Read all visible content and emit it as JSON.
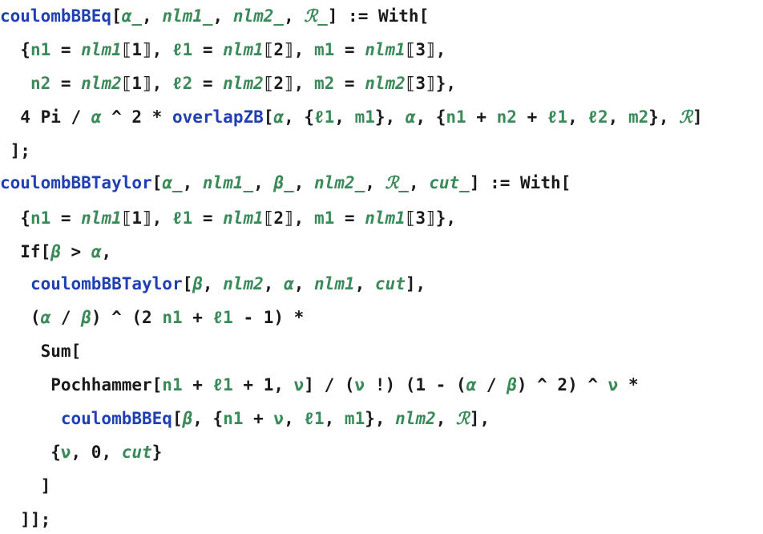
{
  "colors": {
    "function": "#1f3fb3",
    "pattern": "#3a8a5a",
    "local": "#3a8a5a",
    "text": "#1a1a1a",
    "background": "#ffffff"
  },
  "lines": [
    {
      "tokens": [
        {
          "t": "fn",
          "s": "coulombBBEq"
        },
        {
          "t": "sym",
          "s": "["
        },
        {
          "t": "var",
          "s": "α_"
        },
        {
          "t": "sym",
          "s": ", "
        },
        {
          "t": "var",
          "s": "nlm1_"
        },
        {
          "t": "sym",
          "s": ", "
        },
        {
          "t": "var",
          "s": "nlm2_"
        },
        {
          "t": "sym",
          "s": ", "
        },
        {
          "t": "var",
          "s": "ℛ_"
        },
        {
          "t": "sym",
          "s": "] := "
        },
        {
          "t": "plain",
          "s": "With"
        },
        {
          "t": "sym",
          "s": "["
        }
      ]
    },
    {
      "tokens": [
        {
          "t": "sym",
          "s": "  {"
        },
        {
          "t": "loc",
          "s": "n1"
        },
        {
          "t": "sym",
          "s": " = "
        },
        {
          "t": "var",
          "s": "nlm1"
        },
        {
          "t": "sym",
          "s": "⟦1⟧, "
        },
        {
          "t": "loc",
          "s": "ℓ1"
        },
        {
          "t": "sym",
          "s": " = "
        },
        {
          "t": "var",
          "s": "nlm1"
        },
        {
          "t": "sym",
          "s": "⟦2⟧, "
        },
        {
          "t": "loc",
          "s": "m1"
        },
        {
          "t": "sym",
          "s": " = "
        },
        {
          "t": "var",
          "s": "nlm1"
        },
        {
          "t": "sym",
          "s": "⟦3⟧,"
        }
      ]
    },
    {
      "tokens": [
        {
          "t": "sym",
          "s": "   "
        },
        {
          "t": "loc",
          "s": "n2"
        },
        {
          "t": "sym",
          "s": " = "
        },
        {
          "t": "var",
          "s": "nlm2"
        },
        {
          "t": "sym",
          "s": "⟦1⟧, "
        },
        {
          "t": "loc",
          "s": "ℓ2"
        },
        {
          "t": "sym",
          "s": " = "
        },
        {
          "t": "var",
          "s": "nlm2"
        },
        {
          "t": "sym",
          "s": "⟦2⟧, "
        },
        {
          "t": "loc",
          "s": "m2"
        },
        {
          "t": "sym",
          "s": " = "
        },
        {
          "t": "var",
          "s": "nlm2"
        },
        {
          "t": "sym",
          "s": "⟦3⟧},"
        }
      ]
    },
    {
      "tokens": [
        {
          "t": "sym",
          "s": "  4 Pi / "
        },
        {
          "t": "var",
          "s": "α"
        },
        {
          "t": "sym",
          "s": " ^ 2 * "
        },
        {
          "t": "fn",
          "s": "overlapZB"
        },
        {
          "t": "sym",
          "s": "["
        },
        {
          "t": "var",
          "s": "α"
        },
        {
          "t": "sym",
          "s": ", {"
        },
        {
          "t": "loc",
          "s": "ℓ1"
        },
        {
          "t": "sym",
          "s": ", "
        },
        {
          "t": "loc",
          "s": "m1"
        },
        {
          "t": "sym",
          "s": "}, "
        },
        {
          "t": "var",
          "s": "α"
        },
        {
          "t": "sym",
          "s": ", {"
        },
        {
          "t": "loc",
          "s": "n1"
        },
        {
          "t": "sym",
          "s": " + "
        },
        {
          "t": "loc",
          "s": "n2"
        },
        {
          "t": "sym",
          "s": " + "
        },
        {
          "t": "loc",
          "s": "ℓ1"
        },
        {
          "t": "sym",
          "s": ", "
        },
        {
          "t": "loc",
          "s": "ℓ2"
        },
        {
          "t": "sym",
          "s": ", "
        },
        {
          "t": "loc",
          "s": "m2"
        },
        {
          "t": "sym",
          "s": "}, "
        },
        {
          "t": "var",
          "s": "ℛ"
        },
        {
          "t": "sym",
          "s": "]"
        }
      ]
    },
    {
      "tokens": [
        {
          "t": "sym",
          "s": " ];"
        }
      ]
    },
    {
      "tokens": [
        {
          "t": "fn",
          "s": "coulombBBTaylor"
        },
        {
          "t": "sym",
          "s": "["
        },
        {
          "t": "var",
          "s": "α_"
        },
        {
          "t": "sym",
          "s": ", "
        },
        {
          "t": "var",
          "s": "nlm1_"
        },
        {
          "t": "sym",
          "s": ", "
        },
        {
          "t": "var",
          "s": "β_"
        },
        {
          "t": "sym",
          "s": ", "
        },
        {
          "t": "var",
          "s": "nlm2_"
        },
        {
          "t": "sym",
          "s": ", "
        },
        {
          "t": "var",
          "s": "ℛ_"
        },
        {
          "t": "sym",
          "s": ", "
        },
        {
          "t": "var",
          "s": "cut_"
        },
        {
          "t": "sym",
          "s": "] := "
        },
        {
          "t": "plain",
          "s": "With"
        },
        {
          "t": "sym",
          "s": "["
        }
      ]
    },
    {
      "tokens": [
        {
          "t": "sym",
          "s": "  {"
        },
        {
          "t": "loc",
          "s": "n1"
        },
        {
          "t": "sym",
          "s": " = "
        },
        {
          "t": "var",
          "s": "nlm1"
        },
        {
          "t": "sym",
          "s": "⟦1⟧, "
        },
        {
          "t": "loc",
          "s": "ℓ1"
        },
        {
          "t": "sym",
          "s": " = "
        },
        {
          "t": "var",
          "s": "nlm1"
        },
        {
          "t": "sym",
          "s": "⟦2⟧, "
        },
        {
          "t": "loc",
          "s": "m1"
        },
        {
          "t": "sym",
          "s": " = "
        },
        {
          "t": "var",
          "s": "nlm1"
        },
        {
          "t": "sym",
          "s": "⟦3⟧},"
        }
      ]
    },
    {
      "tokens": [
        {
          "t": "sym",
          "s": "  If["
        },
        {
          "t": "var",
          "s": "β"
        },
        {
          "t": "sym",
          "s": " > "
        },
        {
          "t": "var",
          "s": "α"
        },
        {
          "t": "sym",
          "s": ","
        }
      ]
    },
    {
      "tokens": [
        {
          "t": "sym",
          "s": "   "
        },
        {
          "t": "fn",
          "s": "coulombBBTaylor"
        },
        {
          "t": "sym",
          "s": "["
        },
        {
          "t": "var",
          "s": "β"
        },
        {
          "t": "sym",
          "s": ", "
        },
        {
          "t": "var",
          "s": "nlm2"
        },
        {
          "t": "sym",
          "s": ", "
        },
        {
          "t": "var",
          "s": "α"
        },
        {
          "t": "sym",
          "s": ", "
        },
        {
          "t": "var",
          "s": "nlm1"
        },
        {
          "t": "sym",
          "s": ", "
        },
        {
          "t": "var",
          "s": "cut"
        },
        {
          "t": "sym",
          "s": "],"
        }
      ]
    },
    {
      "tokens": [
        {
          "t": "sym",
          "s": "   ("
        },
        {
          "t": "var",
          "s": "α"
        },
        {
          "t": "sym",
          "s": " / "
        },
        {
          "t": "var",
          "s": "β"
        },
        {
          "t": "sym",
          "s": ") ^ (2 "
        },
        {
          "t": "loc",
          "s": "n1"
        },
        {
          "t": "sym",
          "s": " + "
        },
        {
          "t": "loc",
          "s": "ℓ1"
        },
        {
          "t": "sym",
          "s": " - 1) *"
        }
      ]
    },
    {
      "tokens": [
        {
          "t": "sym",
          "s": "    Sum["
        }
      ]
    },
    {
      "tokens": [
        {
          "t": "sym",
          "s": "     Pochhammer["
        },
        {
          "t": "loc",
          "s": "n1"
        },
        {
          "t": "sym",
          "s": " + "
        },
        {
          "t": "loc",
          "s": "ℓ1"
        },
        {
          "t": "sym",
          "s": " + 1, "
        },
        {
          "t": "loc",
          "s": "ν"
        },
        {
          "t": "sym",
          "s": "] / ("
        },
        {
          "t": "loc",
          "s": "ν"
        },
        {
          "t": "sym",
          "s": " !) (1 - ("
        },
        {
          "t": "var",
          "s": "α"
        },
        {
          "t": "sym",
          "s": " / "
        },
        {
          "t": "var",
          "s": "β"
        },
        {
          "t": "sym",
          "s": ") ^ 2) ^ "
        },
        {
          "t": "loc",
          "s": "ν"
        },
        {
          "t": "sym",
          "s": " *"
        }
      ]
    },
    {
      "tokens": [
        {
          "t": "sym",
          "s": "      "
        },
        {
          "t": "fn",
          "s": "coulombBBEq"
        },
        {
          "t": "sym",
          "s": "["
        },
        {
          "t": "var",
          "s": "β"
        },
        {
          "t": "sym",
          "s": ", {"
        },
        {
          "t": "loc",
          "s": "n1"
        },
        {
          "t": "sym",
          "s": " + "
        },
        {
          "t": "loc",
          "s": "ν"
        },
        {
          "t": "sym",
          "s": ", "
        },
        {
          "t": "loc",
          "s": "ℓ1"
        },
        {
          "t": "sym",
          "s": ", "
        },
        {
          "t": "loc",
          "s": "m1"
        },
        {
          "t": "sym",
          "s": "}, "
        },
        {
          "t": "var",
          "s": "nlm2"
        },
        {
          "t": "sym",
          "s": ", "
        },
        {
          "t": "var",
          "s": "ℛ"
        },
        {
          "t": "sym",
          "s": "],"
        }
      ]
    },
    {
      "tokens": [
        {
          "t": "sym",
          "s": "     {"
        },
        {
          "t": "loc",
          "s": "ν"
        },
        {
          "t": "sym",
          "s": ", 0, "
        },
        {
          "t": "var",
          "s": "cut"
        },
        {
          "t": "sym",
          "s": "}"
        }
      ]
    },
    {
      "tokens": [
        {
          "t": "sym",
          "s": "    ]"
        }
      ]
    },
    {
      "tokens": [
        {
          "t": "sym",
          "s": "  ]];"
        }
      ]
    }
  ]
}
